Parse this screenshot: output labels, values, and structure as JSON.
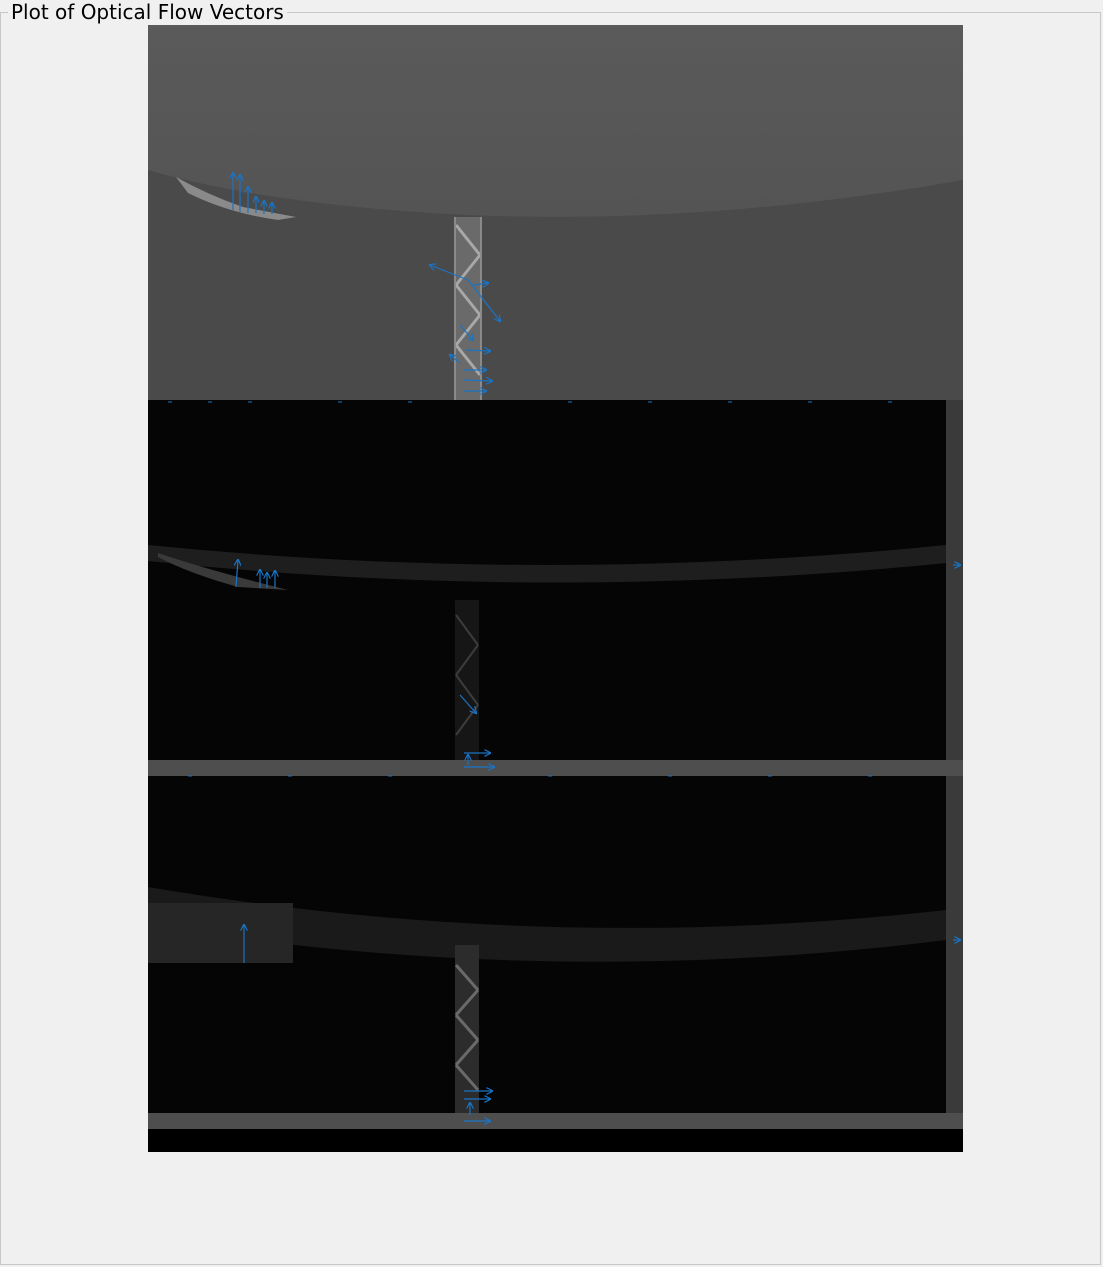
{
  "panel": {
    "title": "Plot of Optical Flow Vectors"
  },
  "image": {
    "description_name": "optical-flow-frame",
    "frames": 3
  },
  "colors": {
    "vector": "#1a74c4",
    "background": "#f0f0f0",
    "panel_border": "#c8c8c8"
  }
}
